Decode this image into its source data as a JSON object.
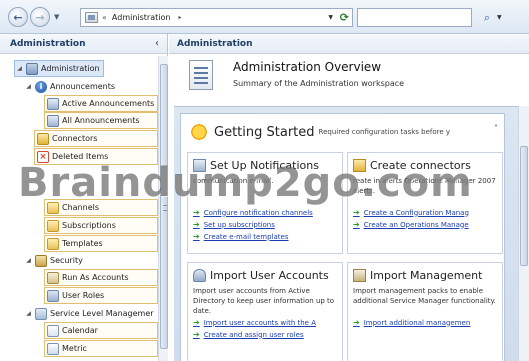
{
  "address_bar": {
    "back_icon": "back-arrow-icon",
    "forward_icon": "forward-arrow-icon",
    "path_prefix": "«",
    "path": "Administration",
    "path_separator": "▸",
    "search_placeholder": ""
  },
  "left_pane": {
    "title": "Administration",
    "collapse_glyph": "‹",
    "tree": [
      {
        "label": "Administration",
        "icon": "administration-icon",
        "selected": true
      },
      {
        "label": "Announcements",
        "icon": "announcements-icon"
      },
      {
        "label": "Active Announcements",
        "icon": "announcement-view-icon"
      },
      {
        "label": "All Announcements",
        "icon": "announcement-view-icon"
      },
      {
        "label": "Connectors",
        "icon": "connectors-icon"
      },
      {
        "label": "Deleted Items",
        "icon": "deleted-items-icon"
      },
      {
        "label": "Channels",
        "icon": "folder-icon"
      },
      {
        "label": "Subscriptions",
        "icon": "folder-icon"
      },
      {
        "label": "Templates",
        "icon": "folder-icon"
      },
      {
        "label": "Security",
        "icon": "security-icon"
      },
      {
        "label": "Run As Accounts",
        "icon": "run-as-icon"
      },
      {
        "label": "User Roles",
        "icon": "user-roles-icon"
      },
      {
        "label": "Service Level Managemer",
        "icon": "service-level-icon"
      },
      {
        "label": "Calendar",
        "icon": "calendar-icon"
      },
      {
        "label": "Metric",
        "icon": "metric-icon"
      }
    ]
  },
  "main": {
    "header": "Administration",
    "overview_title": "Administration Overview",
    "overview_subtitle": "Summary of the Administration workspace",
    "getting_started": {
      "title": "Getting Started",
      "description": "Required configuration tasks before y",
      "collapse_glyph": "˄"
    },
    "cards": [
      {
        "title": "Set Up Notifications",
        "icon": "notifications-icon",
        "description": "communication e-mail.",
        "links": [
          "Configure notification channels",
          "Set up subscriptions",
          "Create e-mail templates"
        ]
      },
      {
        "title": "Create connectors",
        "icon": "connectors-icon",
        "description": "reate in alerts Operations Manager 2007 alerts.",
        "links": [
          "Create a Configuration Manag",
          "Create an Operations Manage"
        ]
      },
      {
        "title": "Import User Accounts",
        "icon": "user-accounts-icon",
        "description": "Import user accounts from Active Directory to keep user information up to date.",
        "links": [
          "Import user accounts with the A",
          "Create and assign user roles"
        ]
      },
      {
        "title": "Import Management",
        "icon": "management-pack-icon",
        "description": "Import management packs to enable additional Service Manager functionality.",
        "links": [
          "Import additional managemen"
        ]
      }
    ]
  },
  "watermark": "Braindump2go.com"
}
